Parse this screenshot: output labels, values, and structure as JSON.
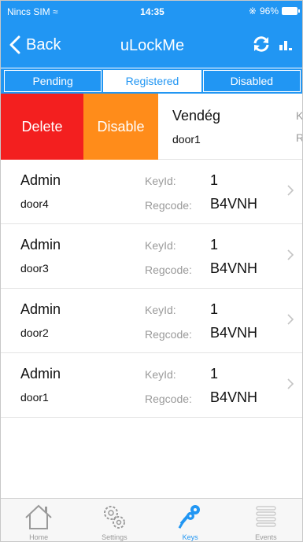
{
  "status": {
    "carrier": "Nincs SIM",
    "time": "14:35",
    "battery": "96%"
  },
  "nav": {
    "back_label": "Back",
    "title": "uLockMe"
  },
  "segments": [
    {
      "label": "Pending",
      "active": false
    },
    {
      "label": "Registered",
      "active": true
    },
    {
      "label": "Disabled",
      "active": false
    }
  ],
  "swiped_row": {
    "delete_label": "Delete",
    "disable_label": "Disable",
    "name": "Vendég",
    "door": "door1",
    "peek_keyid": "K",
    "peek_regcode": "R"
  },
  "rows": [
    {
      "name": "Admin",
      "door": "door4",
      "keyid_label": "KeyId:",
      "keyid": "1",
      "regcode_label": "Regcode:",
      "regcode": "B4VNH"
    },
    {
      "name": "Admin",
      "door": "door3",
      "keyid_label": "KeyId:",
      "keyid": "1",
      "regcode_label": "Regcode:",
      "regcode": "B4VNH"
    },
    {
      "name": "Admin",
      "door": "door2",
      "keyid_label": "KeyId:",
      "keyid": "1",
      "regcode_label": "Regcode:",
      "regcode": "B4VNH"
    },
    {
      "name": "Admin",
      "door": "door1",
      "keyid_label": "KeyId:",
      "keyid": "1",
      "regcode_label": "Regcode:",
      "regcode": "B4VNH"
    }
  ],
  "tabs": [
    {
      "label": "Home",
      "icon": "home-icon",
      "active": false
    },
    {
      "label": "Settings",
      "icon": "gears-icon",
      "active": false
    },
    {
      "label": "Keys",
      "icon": "keys-icon",
      "active": true
    },
    {
      "label": "Events",
      "icon": "list-icon",
      "active": false
    }
  ],
  "colors": {
    "accent": "#2196f3",
    "delete": "#f31f1f",
    "disable": "#ff8c1a",
    "muted_text": "#9a9a9a"
  }
}
